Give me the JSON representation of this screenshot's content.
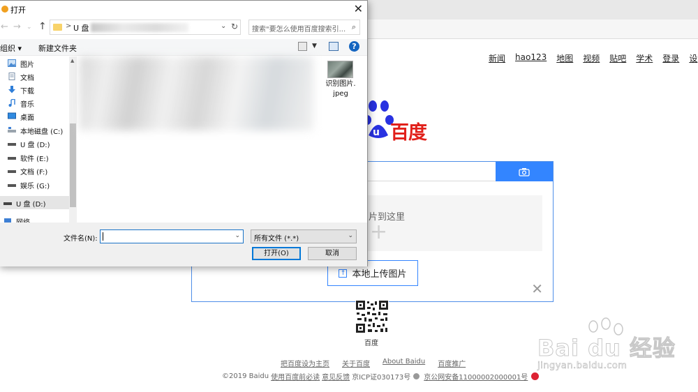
{
  "browser": {
    "nav_links": [
      "新闻",
      "hao123",
      "地图",
      "视频",
      "贴吧",
      "学术",
      "登录",
      "设"
    ],
    "logo_text": "百度",
    "image_search": {
      "drop_text": "片到这里",
      "drop_plus": "+",
      "upload_label": "本地上传图片",
      "close_symbol": "✕"
    },
    "qr_label": "百度",
    "footer_links": [
      "把百度设为主页",
      "关于百度",
      "About  Baidu",
      "百度推广"
    ],
    "footer_line2": {
      "copyright": "©2019 Baidu",
      "must_read": "使用百度前必读",
      "feedback": "意见反馈",
      "icp": "京ICP证030173号",
      "police": "京公网安备11000002000001号"
    },
    "watermark": {
      "main": "Bai du 经验",
      "sub": "jingyan.baidu.com"
    }
  },
  "dialog": {
    "title": "打开",
    "close_symbol": "✕",
    "address": {
      "sep": ">",
      "path": "U 盘"
    },
    "search_placeholder": "搜索\"要怎么使用百度搜索引...",
    "toolbar": {
      "organize": "组织 ▾",
      "new_folder": "新建文件夹",
      "help": "?"
    },
    "nav_items": [
      {
        "label": "图片",
        "icon": "pictures-icon"
      },
      {
        "label": "文档",
        "icon": "documents-icon"
      },
      {
        "label": "下载",
        "icon": "downloads-icon"
      },
      {
        "label": "音乐",
        "icon": "music-icon"
      },
      {
        "label": "桌面",
        "icon": "desktop-icon"
      },
      {
        "label": "本地磁盘 (C:)",
        "icon": "drive-icon"
      },
      {
        "label": "U 盘 (D:)",
        "icon": "usb-drive-icon"
      },
      {
        "label": "软件 (E:)",
        "icon": "drive-icon"
      },
      {
        "label": "文档 (F:)",
        "icon": "drive-icon"
      },
      {
        "label": "娱乐 (G:)",
        "icon": "drive-icon"
      },
      {
        "label": "U 盘 (D:)",
        "icon": "usb-drive-icon"
      },
      {
        "label": "网络",
        "icon": "network-icon"
      }
    ],
    "file": {
      "name_line1": "识别图片.",
      "name_line2": "jpeg"
    },
    "filename_label": "文件名(N):",
    "filename_value": "",
    "filetype_value": "所有文件 (*.*)",
    "open_label": "打开(O)",
    "cancel_label": "取消",
    "colors": {
      "accent": "#0078d7",
      "brand_red": "#e1201a",
      "baidu_blue": "#3385ff"
    }
  }
}
